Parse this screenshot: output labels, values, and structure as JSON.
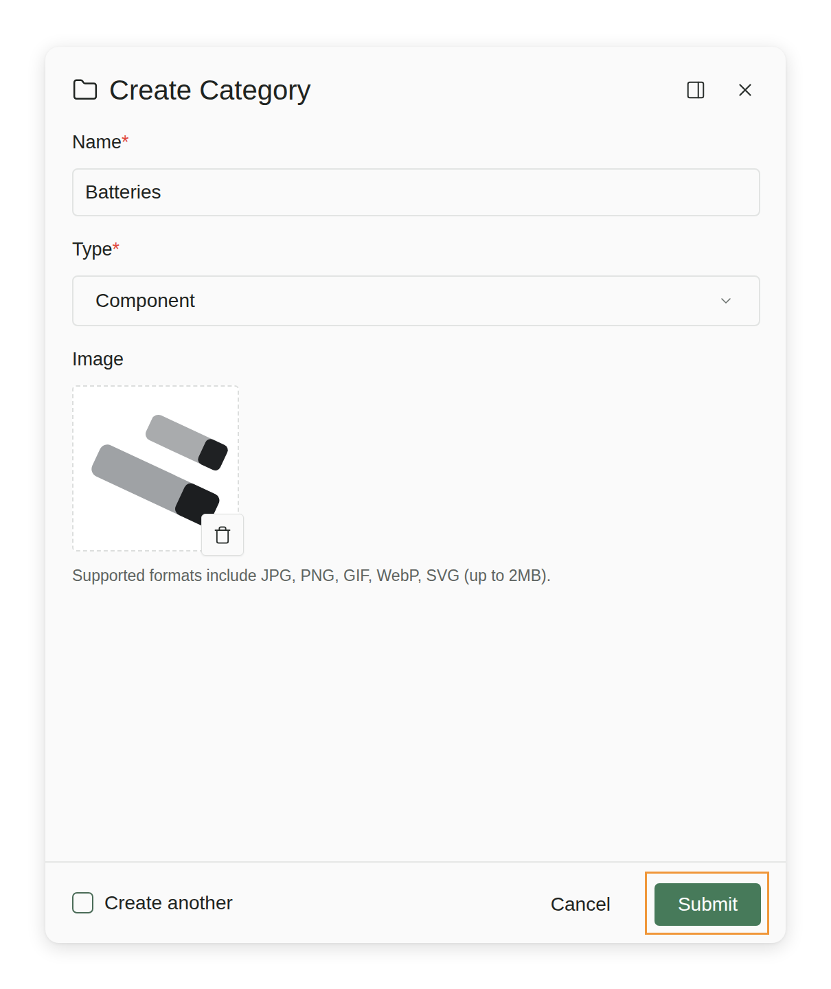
{
  "window": {
    "title": "Create Category"
  },
  "fields": [
    {
      "kind": "text",
      "label": "Name",
      "required": true,
      "value": "Batteries"
    },
    {
      "kind": "select",
      "label": "Type",
      "required": true,
      "value": "Component"
    }
  ],
  "image": {
    "label": "Image",
    "has_image": true,
    "helper": "Supported formats include JPG, PNG, GIF, WebP, SVG (up to 2MB)."
  },
  "required_mark": "*",
  "footer": {
    "create_another": {
      "label": "Create another",
      "checked": false
    },
    "buttons": [
      {
        "label": "Cancel",
        "kind": "secondary",
        "highlighted": false
      },
      {
        "label": "Submit",
        "kind": "primary",
        "highlighted": true
      }
    ]
  }
}
